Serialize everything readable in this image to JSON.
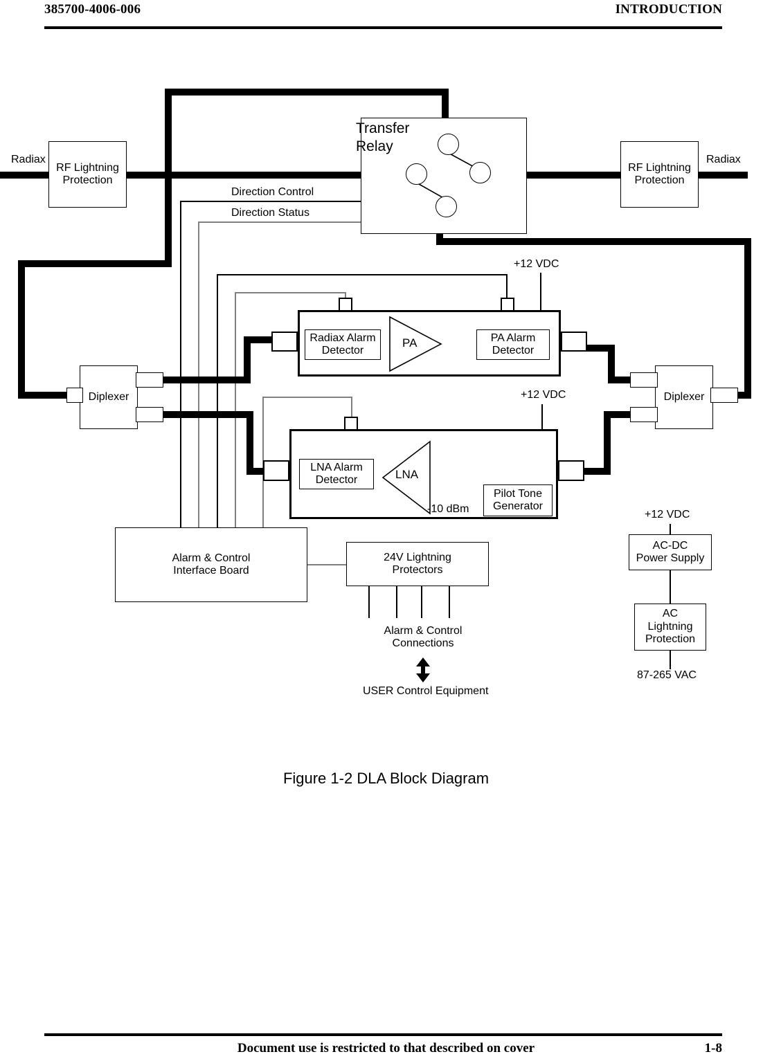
{
  "header": {
    "doc_number": "385700-4006-006",
    "section": "INTRODUCTION"
  },
  "footer": {
    "notice": "Document use is restricted to that described on cover",
    "page": "1-8"
  },
  "caption": "Figure 1-2  DLA Block Diagram",
  "diagram": {
    "blocks": {
      "rf_lightning_left": "RF Lightning\nProtection",
      "rf_lightning_left_l1": "RF Lightning",
      "rf_lightning_left_l2": "Protection",
      "rf_lightning_right_l1": "RF Lightning",
      "rf_lightning_right_l2": "Protection",
      "transfer_relay_l1": "Transfer",
      "transfer_relay_l2": "Relay",
      "diplexer_left": "Diplexer",
      "diplexer_right": "Diplexer",
      "radiax_alarm_detector_l1": "Radiax Alarm",
      "radiax_alarm_detector_l2": "Detector",
      "pa_alarm_detector_l1": "PA Alarm",
      "pa_alarm_detector_l2": "Detector",
      "lna_alarm_detector_l1": "LNA Alarm",
      "lna_alarm_detector_l2": "Detector",
      "pilot_tone_generator_l1": "Pilot Tone",
      "pilot_tone_generator_l2": "Generator",
      "alarm_control_board_l1": "Alarm & Control",
      "alarm_control_board_l2": "Interface Board",
      "lightning_protectors_l1": "24V Lightning",
      "lightning_protectors_l2": "Protectors",
      "ac_dc_supply_l1": "AC-DC",
      "ac_dc_supply_l2": "Power Supply",
      "ac_lightning_l1": "AC",
      "ac_lightning_l2": "Lightning",
      "ac_lightning_l3": "Protection",
      "pa_amp": "PA",
      "lna_amp": "LNA"
    },
    "labels": {
      "radiax_left": "Radiax",
      "radiax_right": "Radiax",
      "direction_control": "Direction Control",
      "direction_status": "Direction Status",
      "vdc_pa": "+12 VDC",
      "vdc_lna": "+12 VDC",
      "vdc_supply": "+12 VDC",
      "dbm": "-10 dBm",
      "alarm_connections_l1": "Alarm & Control",
      "alarm_connections_l2": "Connections",
      "user_control_equipment": "USER Control Equipment",
      "ac_input": "87-265 VAC"
    }
  }
}
